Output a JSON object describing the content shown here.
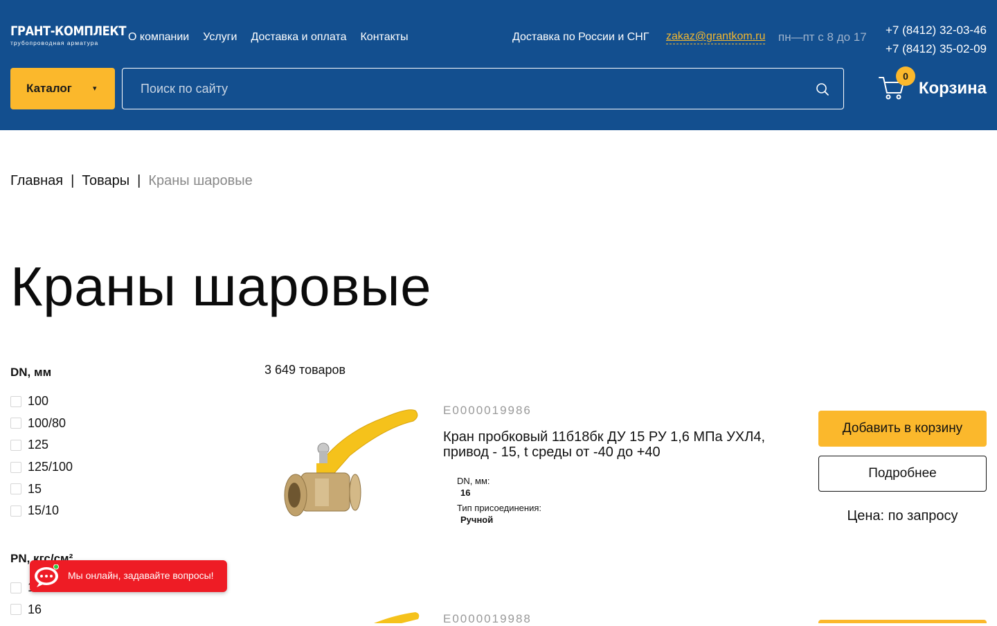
{
  "header": {
    "logo_main": "ГРАНТ-КОМПЛЕКТ",
    "logo_sub": "трубопроводная арматура",
    "nav": [
      "О компании",
      "Услуги",
      "Доставка и оплата",
      "Контакты"
    ],
    "delivery": "Доставка по России и СНГ",
    "email": "zakaz@grantkom.ru",
    "hours": "пн—пт с 8 до 17",
    "phones": [
      "+7 (8412) 32-03-46",
      "+7 (8412) 35-02-09"
    ],
    "catalog_label": "Каталог",
    "catalog_caret": "▾",
    "search_placeholder": "Поиск по сайту",
    "cart_label": "Корзина",
    "cart_count": "0"
  },
  "breadcrumb": {
    "items": [
      "Главная",
      "Товары"
    ],
    "separator": "|",
    "current": "Краны шаровые"
  },
  "page_title": "Краны шаровые",
  "filters": {
    "dn": {
      "title": "DN, мм",
      "options": [
        "100",
        "100/80",
        "125",
        "125/100",
        "15",
        "15/10"
      ]
    },
    "pn": {
      "title": "PN, кгс/см²",
      "options": [
        "10",
        "16"
      ]
    }
  },
  "product_count": "3 649 товаров",
  "products": [
    {
      "sku": "E0000019986",
      "name": "Кран пробковый 11б18бк ДУ 15 РУ 1,6 МПа УХЛ4, привод - 15, t среды от -40 до +40",
      "specs": [
        {
          "label": "DN, мм:",
          "value": "16"
        },
        {
          "label": "Тип присоединения:",
          "value": "Ручной"
        }
      ],
      "add_button": "Добавить в корзину",
      "more_button": "Подробнее",
      "price": "Цена: по запросу"
    },
    {
      "sku": "E0000019988"
    }
  ],
  "chat": {
    "text": "Мы онлайн, задавайте вопросы!"
  },
  "colors": {
    "header_bg": "#134f8f",
    "accent": "#fbb82c",
    "chat_bg": "#ee1c25"
  }
}
